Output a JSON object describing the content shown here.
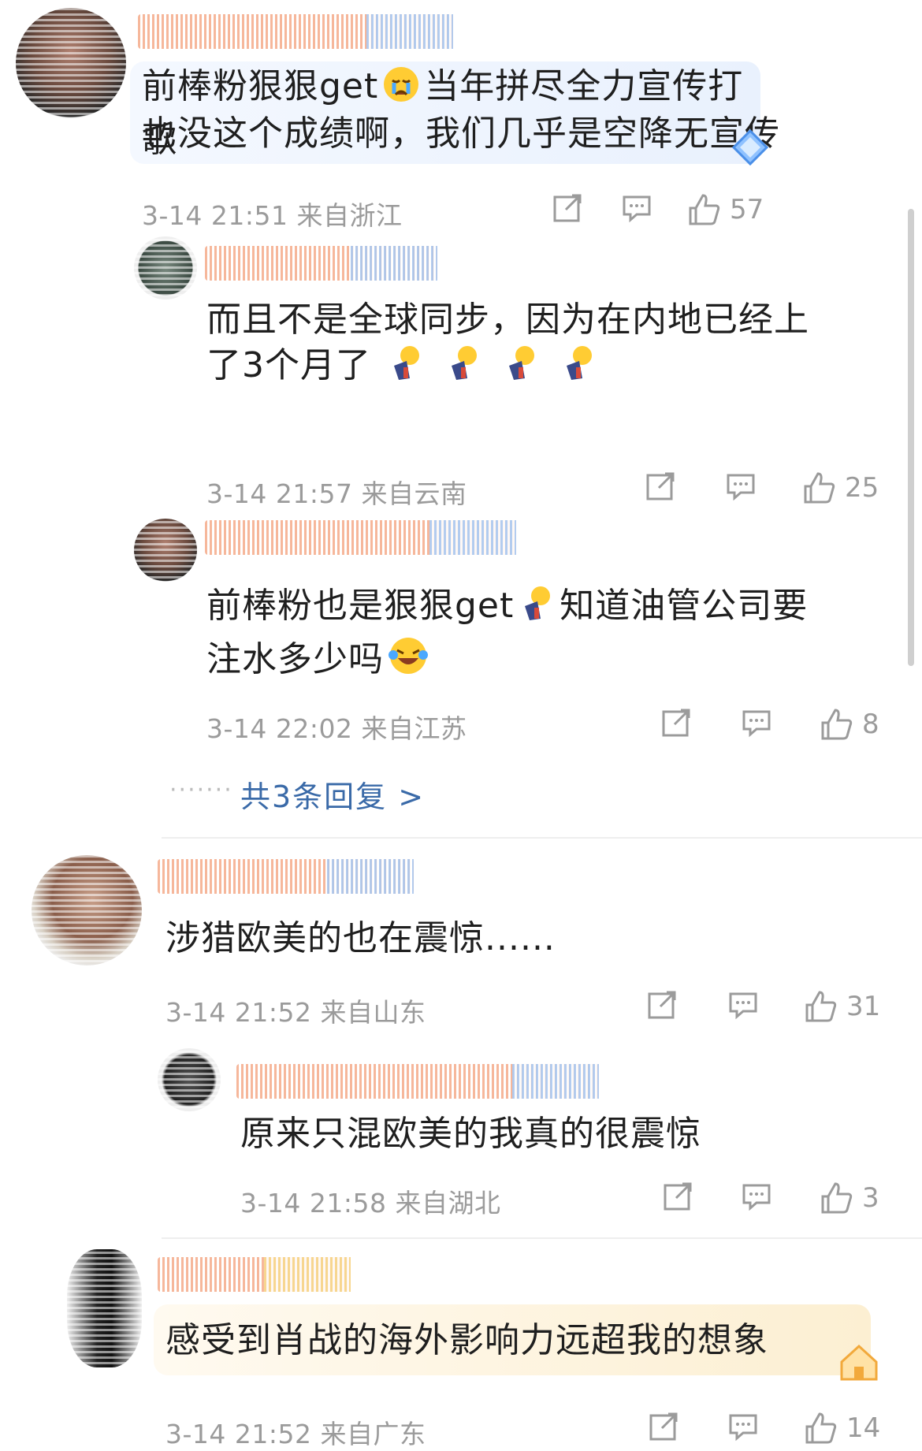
{
  "comments": [
    {
      "text_line1": "前棒粉狠狠get",
      "text_line1b": "当年拼尽全力宣传打歌",
      "text_line2": "也没这个成绩啊，我们几乎是空降无宣传",
      "meta": "3-14 21:51 来自浙江",
      "likes": "57",
      "replies": [
        {
          "text_line1": "而且不是全球同步，因为在内地已经上",
          "text_line2": "了3个月了",
          "meta": "3-14 21:57 来自云南",
          "likes": "25"
        },
        {
          "text_line1a": "前棒粉也是狠狠get",
          "text_line1b": "知道油管公司要",
          "text_line2": "注水多少吗",
          "meta": "3-14 22:02 来自江苏",
          "likes": "8"
        }
      ],
      "more_replies": "共3条回复 >"
    },
    {
      "text": "涉猎欧美的也在震惊......",
      "meta": "3-14 21:52 来自山东",
      "likes": "31",
      "replies": [
        {
          "text": "原来只混欧美的我真的很震惊",
          "meta": "3-14 21:58 来自湖北",
          "likes": "3"
        }
      ]
    },
    {
      "text": "感受到肖战的海外影响力远超我的想象",
      "meta": "3-14 21:52 来自广东",
      "likes": "14"
    }
  ],
  "icons": {
    "share": "share-icon",
    "comment": "comment-icon",
    "like": "thumbs-up-icon"
  },
  "colors": {
    "link": "#3a6aa8",
    "meta": "#9b9b9b",
    "bubble_blue": "#eef4fd",
    "bubble_gold": "#fdf6e8"
  }
}
